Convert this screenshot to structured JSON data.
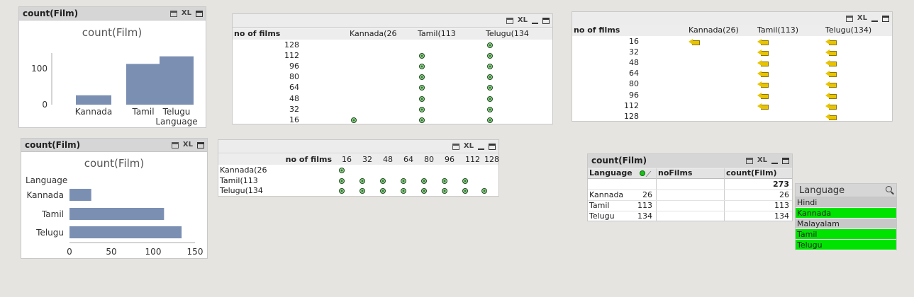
{
  "colors": {
    "bar": "#7b8fb3",
    "selected": "#00e300",
    "alternative": "#c8c8c8",
    "caption": "#d6d6d6",
    "arrow": "#e8c400",
    "dot": "#2e7d32"
  },
  "icons": {
    "print": "print-icon",
    "xl": "excel-icon",
    "minimize": "minimize-icon",
    "maximize": "maximize-icon",
    "search": "search-icon",
    "arrow": "left-arrow-icon",
    "dot": "green-dot-icon"
  },
  "icon_labels": {
    "xl": "XL"
  },
  "chart1": {
    "caption": "count(Film)",
    "chart_data": {
      "type": "bar",
      "title": "count(Film)",
      "categories": [
        "Kannada",
        "Tamil",
        "Telugu"
      ],
      "values": [
        26,
        113,
        134
      ],
      "xlabel": "Language",
      "ylabel": "",
      "yticks": [
        "0",
        "100"
      ],
      "ylim": [
        0,
        140
      ]
    }
  },
  "chart2": {
    "caption": "count(Film)",
    "chart_data": {
      "type": "bar",
      "orientation": "horizontal",
      "title": "count(Film)",
      "categories": [
        "Kannada",
        "Tamil",
        "Telugu"
      ],
      "values": [
        26,
        113,
        134
      ],
      "ylabel": "Language",
      "xticks": [
        "0",
        "50",
        "100",
        "150"
      ],
      "xlim": [
        0,
        150
      ]
    }
  },
  "pivot1": {
    "header": "no of films",
    "columns": [
      "Kannada(26",
      "Tamil(113",
      "Telugu(134"
    ],
    "rows": [
      "128",
      "112",
      "96",
      "80",
      "64",
      "48",
      "32",
      "16"
    ],
    "counts": [
      1,
      7,
      8
    ]
  },
  "pivot2": {
    "header": "no of films",
    "columns": [
      "Kannada(26)",
      "Tamil(113)",
      "Telugu(134)"
    ],
    "rows": [
      "16",
      "32",
      "48",
      "64",
      "80",
      "96",
      "112",
      "128"
    ],
    "counts": [
      1,
      7,
      8
    ]
  },
  "pivot3": {
    "header": "no of films",
    "columns": [
      "16",
      "32",
      "48",
      "64",
      "80",
      "96",
      "112",
      "128"
    ],
    "rows": [
      "Kannada(26",
      "Tamil(113",
      "Telugu(134"
    ],
    "counts": [
      1,
      7,
      8
    ]
  },
  "table": {
    "caption": "count(Film)",
    "headers": [
      "Language",
      "noFilms",
      "count(Film)"
    ],
    "total": "273",
    "rows": [
      {
        "lang": "Kannada",
        "nofilms": "26",
        "count": "26"
      },
      {
        "lang": "Tamil",
        "nofilms": "113",
        "count": "113"
      },
      {
        "lang": "Telugu",
        "nofilms": "134",
        "count": "134"
      }
    ]
  },
  "listbox": {
    "caption": "Language",
    "items": [
      {
        "label": "Hindi",
        "state": "alternative"
      },
      {
        "label": "Kannada",
        "state": "selected"
      },
      {
        "label": "Malayalam",
        "state": "alternative"
      },
      {
        "label": "Tamil",
        "state": "selected"
      },
      {
        "label": "Telugu",
        "state": "selected"
      }
    ]
  }
}
